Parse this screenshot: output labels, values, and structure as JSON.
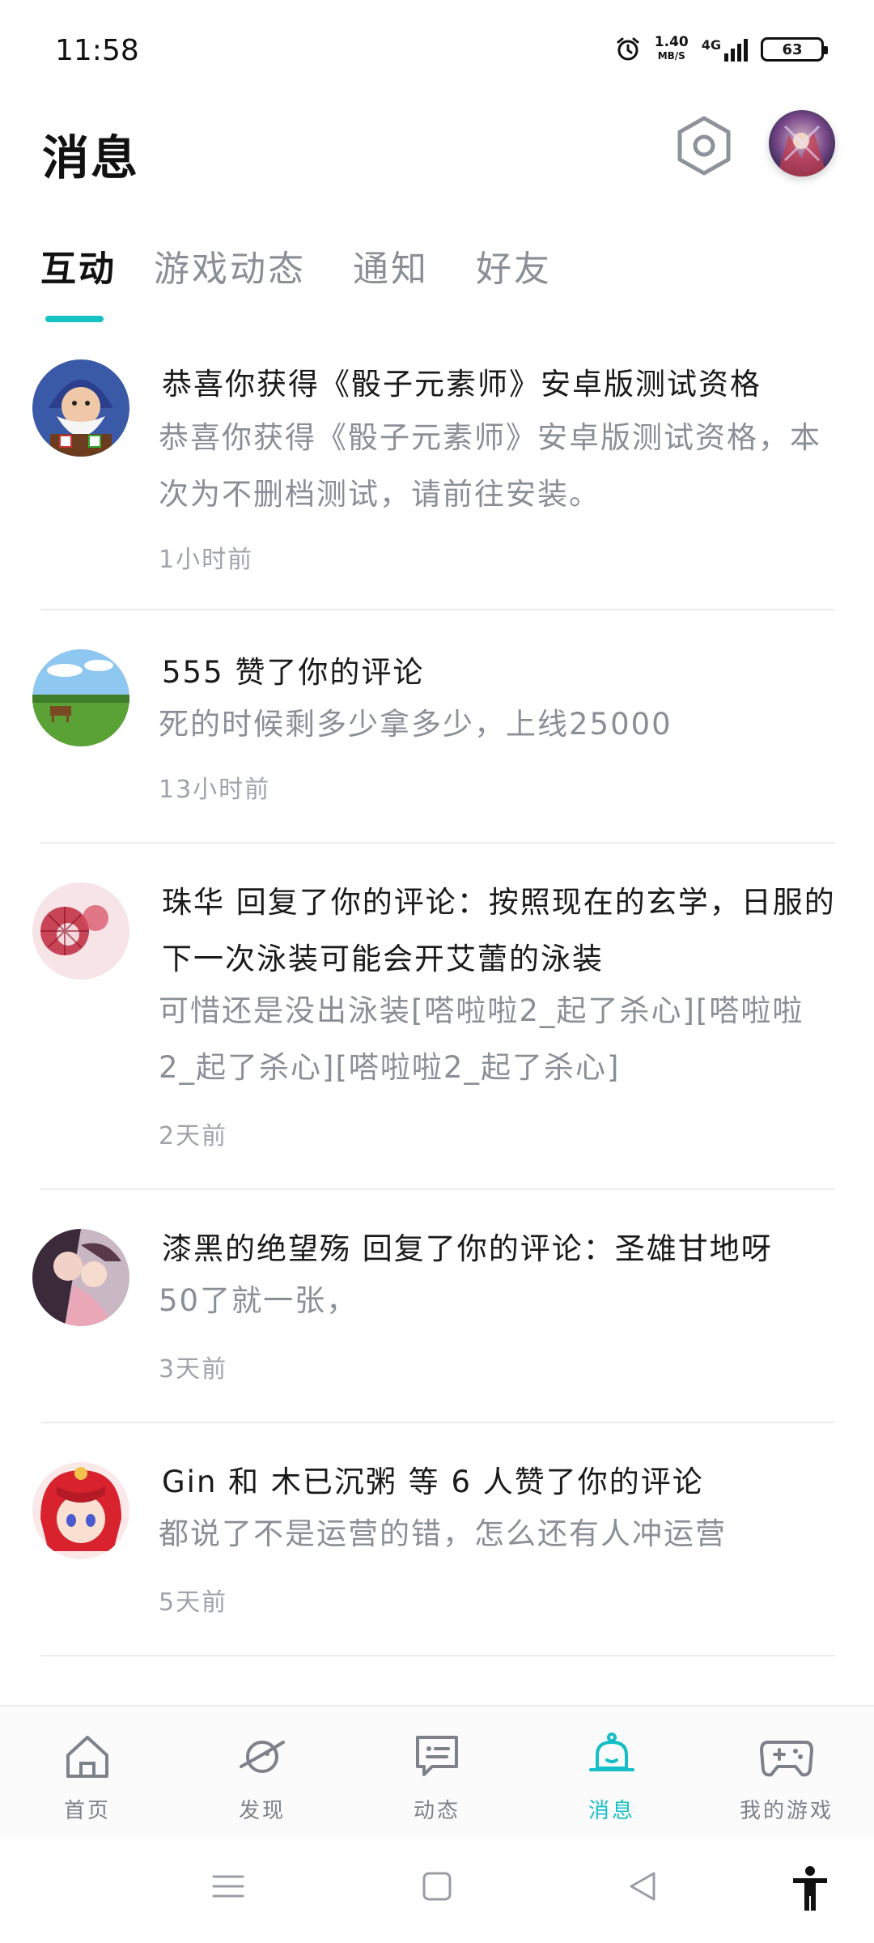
{
  "status_bar": {
    "time": "11:58",
    "net_speed": "1.40",
    "net_unit": "MB/S",
    "network": "4G",
    "battery": "63"
  },
  "header": {
    "title": "消息",
    "settings_icon": "hexagon-settings-icon",
    "avatar_icon": "user-avatar"
  },
  "tabs": [
    {
      "label": "互动",
      "active": true
    },
    {
      "label": "游戏动态",
      "active": false
    },
    {
      "label": "通知",
      "active": false
    },
    {
      "label": "好友",
      "active": false
    }
  ],
  "messages": [
    {
      "title": "恭喜你获得《骰子元素师》安卓版测试资格",
      "body": "恭喜你获得《骰子元素师》安卓版测试资格，本次为不删档测试，请前往安装。",
      "time": "1小时前"
    },
    {
      "title": "555 赞了你的评论",
      "body": "死的时候剩多少拿多少，上线25000",
      "time": "13小时前"
    },
    {
      "title": "珠华 回复了你的评论：按照现在的玄学，日服的下一次泳装可能会开艾蕾的泳装",
      "body": "可惜还是没出泳装[嗒啦啦2_起了杀心][嗒啦啦2_起了杀心][嗒啦啦2_起了杀心]",
      "time": "2天前"
    },
    {
      "title": "漆黑的绝望殇 回复了你的评论：圣雄甘地呀",
      "body": "50了就一张，",
      "time": "3天前"
    },
    {
      "title": "Gin 和 木已沉粥 等 6 人赞了你的评论",
      "body": "都说了不是运营的错，怎么还有人冲运营",
      "time": "5天前"
    }
  ],
  "bottom_nav": [
    {
      "label": "首页",
      "icon": "home-icon",
      "active": false
    },
    {
      "label": "发现",
      "icon": "planet-icon",
      "active": false
    },
    {
      "label": "动态",
      "icon": "chat-icon",
      "active": false
    },
    {
      "label": "消息",
      "icon": "bell-icon",
      "active": true
    },
    {
      "label": "我的游戏",
      "icon": "gamepad-icon",
      "active": false
    }
  ],
  "colors": {
    "accent": "#16c3c3",
    "text": "#1a1a1a",
    "muted": "#8a8f96"
  }
}
